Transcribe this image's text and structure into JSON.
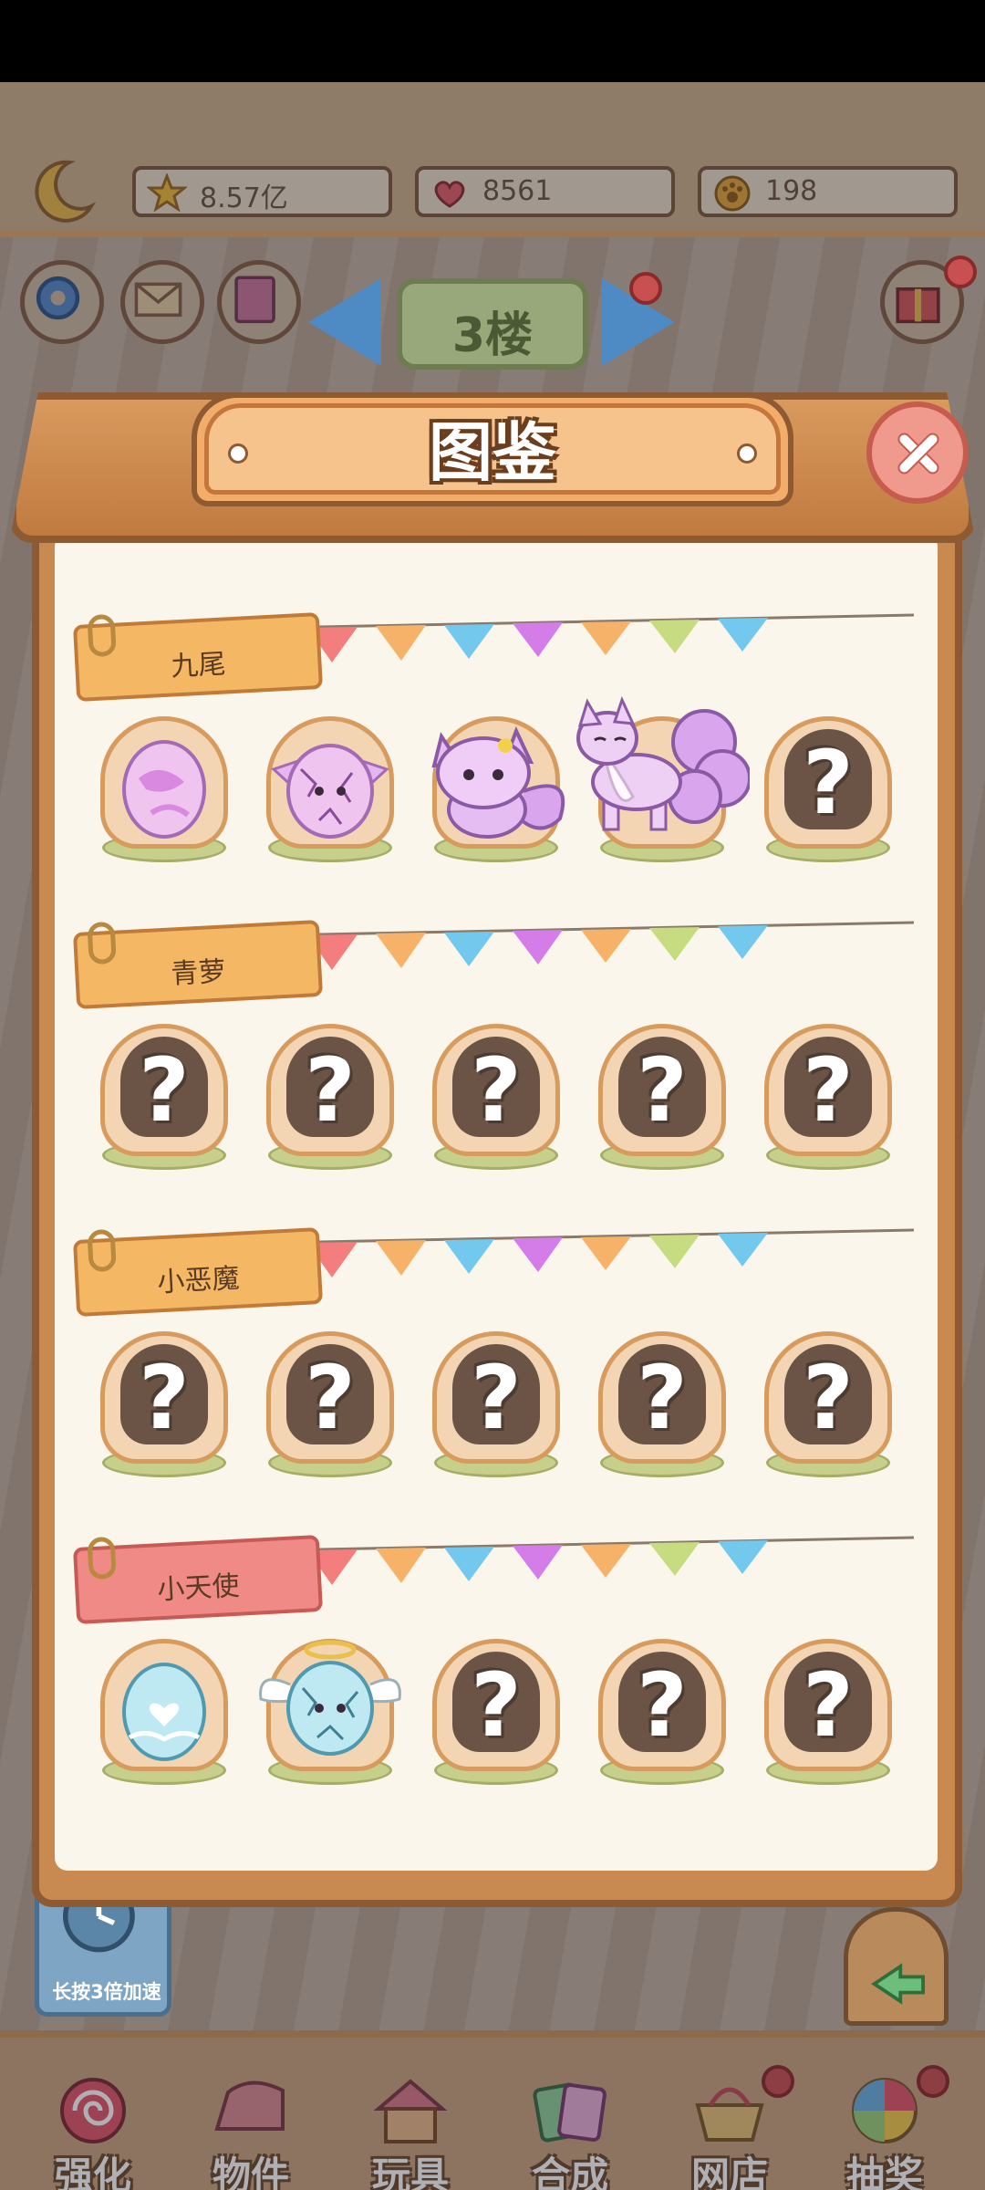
{
  "status_bar": {},
  "resources": {
    "stars": "8.57亿",
    "hearts": "8561",
    "coins": "198"
  },
  "world": {
    "floor_label": "3楼",
    "speed_button_label": "长按3倍加速"
  },
  "modal": {
    "title": "图鉴",
    "sections": [
      {
        "name": "九尾",
        "tag_color": "orange",
        "slots": [
          "egg-pink",
          "hatchling-pink",
          "kitsune-small",
          "kitsune-adult",
          "locked"
        ]
      },
      {
        "name": "青萝",
        "tag_color": "orange",
        "slots": [
          "locked",
          "locked",
          "locked",
          "locked",
          "locked"
        ]
      },
      {
        "name": "小恶魔",
        "tag_color": "orange",
        "slots": [
          "locked",
          "locked",
          "locked",
          "locked",
          "locked"
        ]
      },
      {
        "name": "小天使",
        "tag_color": "pink",
        "slots": [
          "egg-blue",
          "hatchling-angel",
          "locked",
          "locked",
          "locked"
        ]
      }
    ],
    "locked_glyph": "?"
  },
  "bottom_nav": {
    "items": [
      {
        "label": "强化",
        "icon": "lollipop-icon",
        "badge": false
      },
      {
        "label": "物件",
        "icon": "piano-icon",
        "badge": false
      },
      {
        "label": "玩具",
        "icon": "house-toy-icon",
        "badge": false
      },
      {
        "label": "合成",
        "icon": "cards-icon",
        "badge": false
      },
      {
        "label": "网店",
        "icon": "basket-icon",
        "badge": true
      },
      {
        "label": "抽奖",
        "icon": "wheel-icon",
        "badge": true
      }
    ]
  },
  "colors": {
    "panel_wood": "#c98a52",
    "panel_inner": "#fbf6ec",
    "tag_orange": "#f4b865",
    "tag_pink": "#ef8a86",
    "close_button": "#ef9a8c"
  }
}
